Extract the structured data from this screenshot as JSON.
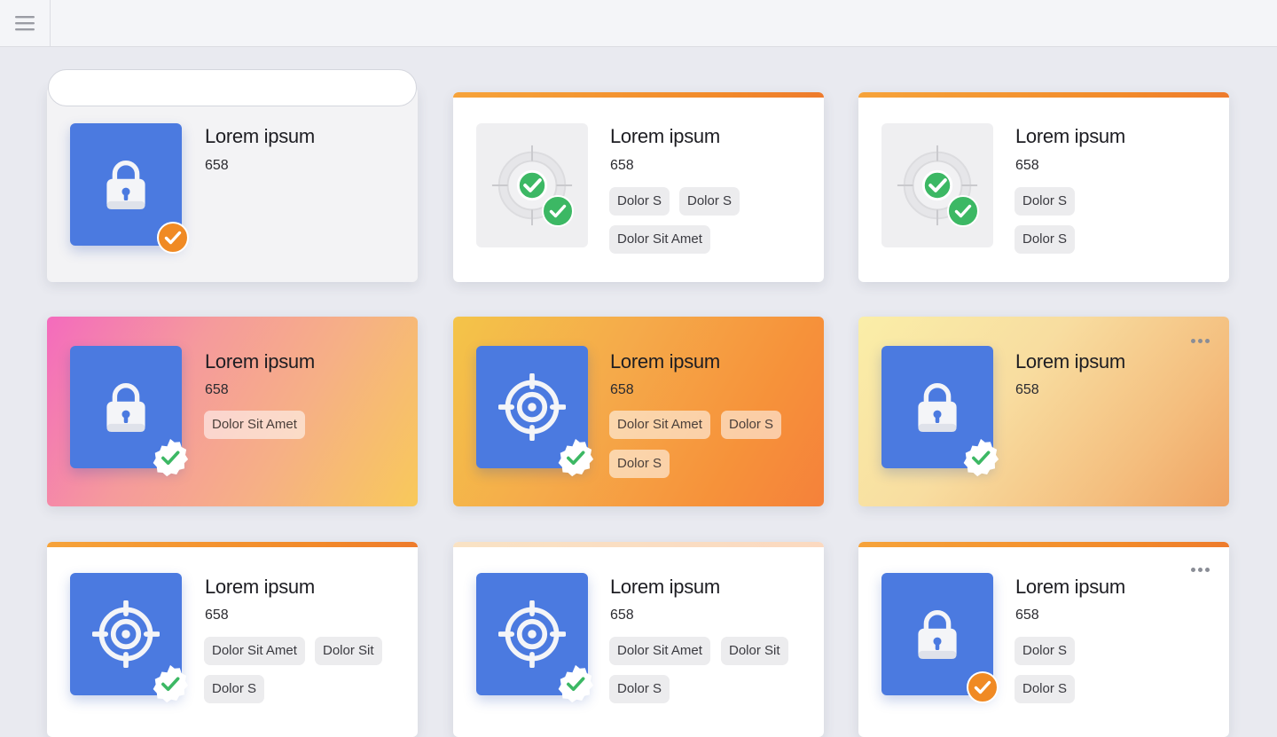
{
  "colors": {
    "accent_blue": "#4b7ae0",
    "check_green": "#3cb864",
    "check_orange": "#f08a24",
    "stripe_orange": "#f28a2a"
  },
  "cards": [
    {
      "title": "Lorem ipsum",
      "count": "658",
      "icon": "lock-icon",
      "badge": "orange-check-badge",
      "chips": []
    },
    {
      "title": "Lorem ipsum",
      "count": "658",
      "icon": "target-check-icon",
      "badge": "green-check-badge",
      "chips": [
        "Dolor S",
        "Dolor S",
        "Dolor Sit Amet"
      ]
    },
    {
      "title": "Lorem ipsum",
      "count": "658",
      "icon": "target-check-icon",
      "badge": "green-check-badge",
      "chips": [
        "Dolor S",
        "Dolor S"
      ]
    },
    {
      "title": "Lorem ipsum",
      "count": "658",
      "icon": "lock-icon",
      "badge": "green-seal-badge",
      "chips": [
        "Dolor Sit Amet"
      ]
    },
    {
      "title": "Lorem ipsum",
      "count": "658",
      "icon": "target-icon",
      "badge": "green-seal-badge",
      "chips": [
        "Dolor Sit Amet",
        "Dolor S",
        "Dolor S"
      ]
    },
    {
      "title": "Lorem ipsum",
      "count": "658",
      "icon": "lock-icon",
      "badge": "green-seal-badge",
      "chips": [],
      "menu": "more-icon"
    },
    {
      "title": "Lorem ipsum",
      "count": "658",
      "icon": "target-icon",
      "badge": "green-seal-badge",
      "chips": [
        "Dolor Sit Amet",
        "Dolor Sit",
        "Dolor S"
      ]
    },
    {
      "title": "Lorem ipsum",
      "count": "658",
      "icon": "target-icon",
      "badge": "green-seal-badge",
      "chips": [
        "Dolor Sit Amet",
        "Dolor Sit",
        "Dolor S"
      ]
    },
    {
      "title": "Lorem ipsum",
      "count": "658",
      "icon": "lock-icon",
      "badge": "orange-check-badge",
      "chips": [
        "Dolor S",
        "Dolor S"
      ],
      "menu": "more-icon"
    }
  ]
}
